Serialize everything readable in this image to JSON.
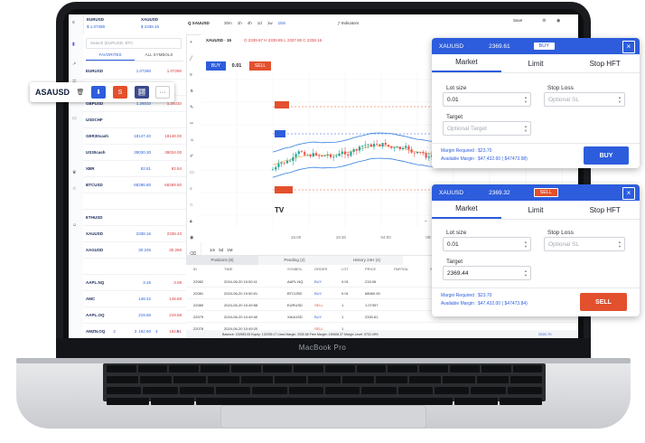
{
  "laptop": {
    "brand": "MacBook Pro"
  },
  "toolbar": {
    "eur": "EURUSD",
    "eur_price": "$ 1.07289",
    "xau": "XAUUSD",
    "xau_price": "$ 2338.16",
    "symbol": "Q XAUUSD",
    "intervals": [
      "30m",
      "1h",
      "4h",
      "1d",
      "1w",
      "15m"
    ],
    "indicators": "Indicators",
    "save": "Save"
  },
  "watchlist": {
    "search_placeholder": "Search (EURUSD, BTC",
    "tabs": [
      "FAVORITES",
      "ALL SYMBOLS"
    ],
    "rows": [
      {
        "sym": "EURUSD",
        "bid": "1.07280",
        "ask": "1.07290"
      },
      {
        "sym": "",
        "bid": "",
        "ask": ""
      },
      {
        "sym": "GBPUSD",
        "bid": "1.26010",
        "ask": "1.26030"
      },
      {
        "sym": "USDCHF",
        "bid": "",
        "ask": ""
      },
      {
        "sym": "GER30cash",
        "bid": "18147.40",
        "ask": "18148.00"
      },
      {
        "sym": "US30cash",
        "bid": "39030.30",
        "ask": "39034.00"
      },
      {
        "sym": "XBR",
        "bid": "82.81",
        "ask": "82.84"
      },
      {
        "sym": "BTCUSD",
        "bid": "68286.80",
        "ask": "68289.50"
      },
      {
        "sym": "",
        "bid": "",
        "ask": ""
      },
      {
        "sym": "ETHUSD",
        "bid": "",
        "ask": ""
      },
      {
        "sym": "XAUUSD",
        "bid": "2338.16",
        "ask": "2338.43"
      },
      {
        "sym": "XAGUSD",
        "bid": "30.245",
        "ask": "30.268"
      },
      {
        "sym": "",
        "bid": "",
        "ask": ""
      },
      {
        "sym": "AAPL.NQ",
        "bid": "3.16",
        "ask": "3.08"
      },
      {
        "sym": "AMC",
        "bid": "148.22",
        "ask": "148.68"
      },
      {
        "sym": "AAPL.OQ",
        "bid": "219.56",
        "ask": "219.68"
      },
      {
        "sym": "AMZN.OQ",
        "bid": "182.90",
        "ask": "182.91"
      }
    ],
    "pages": [
      "1",
      "2",
      "3",
      "4",
      "5"
    ]
  },
  "chip": {
    "symbol": "ASAUSD",
    "sell": "S"
  },
  "chart": {
    "title": "XAUUSD · 15",
    "ohlc": "O 2339.67  H 2339.85  L 2337.80  C 2338.16",
    "buy": "BUY",
    "spread": "0.01",
    "sell": "SELL",
    "ranges": [
      "1m",
      "5d",
      "1M"
    ],
    "times": [
      "15:00",
      "19:30",
      "04:00",
      "09:30",
      "16:00",
      "19:00"
    ]
  },
  "positions": {
    "tabs": [
      "Positions (5)",
      "Pending (2)",
      "History 24H (4)"
    ],
    "headers": [
      "ID",
      "TIME",
      "SYMBOL",
      "ORDER",
      "LOT",
      "PRICE",
      "PARTIAL",
      "SL"
    ],
    "rows": [
      {
        "id": "22082",
        "time": "2024-06-20 10:50:11",
        "sym": "AAPL.NQ",
        "order": "BUY",
        "lot": "0.01",
        "price": "215.06"
      },
      {
        "id": "22081",
        "time": "2024-06-20 10:50:01",
        "sym": "BTCUSD",
        "order": "BUY",
        "lot": "0.01",
        "price": "68060.00"
      },
      {
        "id": "22080",
        "time": "2024-06-20 10:49:58",
        "sym": "EURUSD",
        "order": "SELL",
        "lot": "1",
        "price": "1.07397"
      },
      {
        "id": "22079",
        "time": "2024-06-20 10:49:40",
        "sym": "XAUUSD",
        "order": "BUY",
        "lot": "1",
        "price": "2330.61"
      },
      {
        "id": "22078",
        "time": "2024-06-20 10:49:20",
        "sym": "",
        "order": "SELL",
        "lot": "1",
        "price": ""
      }
    ],
    "status": "Balance: 132983.05   Equity: 132939.17   Used Margin: 2330.68   Free Margin: 130608.37   Margin Level: 5702.49%",
    "right_value": "2520.70"
  },
  "buy_panel": {
    "symbol": "XAUUSD",
    "price": "2369.61",
    "side": "BUY",
    "tabs": [
      "Market",
      "Limit",
      "Stop HFT"
    ],
    "lot_label": "Lot size",
    "lot_value": "0.01",
    "sl_label": "Stop Loss",
    "sl_placeholder": "Optional SL",
    "target_label": "Target",
    "target_placeholder": "Optional Target",
    "margin_required": "Margin Required : $23.70",
    "available_margin": "Available Margin : $47,432.60 ( $47473.98)",
    "action": "BUY",
    "close": "×"
  },
  "sell_panel": {
    "symbol": "XAUUSD",
    "price": "2369.32",
    "side": "SELL",
    "tabs": [
      "Market",
      "Limit",
      "Stop HFT"
    ],
    "lot_label": "Lot size",
    "lot_value": "0.01",
    "sl_label": "Stop Loss",
    "sl_placeholder": "Optional SL",
    "target_label": "Target",
    "target_value": "2369.44",
    "margin_required": "Margin Required : $23.70",
    "available_margin": "Available Margin : $47,432.00 ( $47473.84)",
    "action": "SELL",
    "close": "×"
  },
  "colors": {
    "blue": "#2d5ddc",
    "red": "#e3502d",
    "up": "#26a69a",
    "down": "#ef5350",
    "band": "#2f7fe0"
  }
}
